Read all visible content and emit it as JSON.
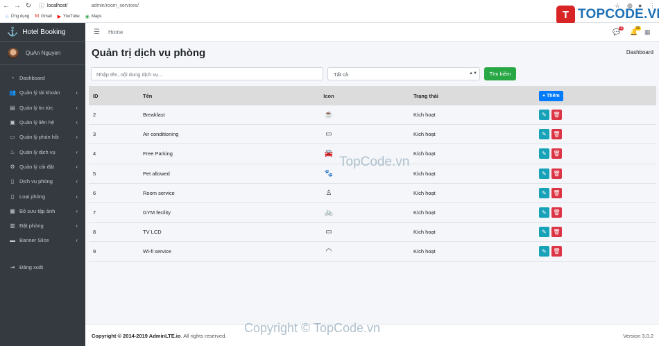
{
  "browser": {
    "url_host": "localhost/",
    "url_path": "admin/room_services/",
    "bookmarks": [
      {
        "label": "Ứng dụng",
        "icon": "apps-icon"
      },
      {
        "label": "Gmail",
        "icon": "gmail-icon"
      },
      {
        "label": "YouTube",
        "icon": "youtube-icon"
      },
      {
        "label": "Maps",
        "icon": "maps-icon"
      }
    ]
  },
  "watermark": {
    "logo_letter": "T",
    "logo_text": "TOPCODE.VN",
    "mid": "TopCode.vn",
    "copy": "Copyright © TopCode.vn"
  },
  "sidebar": {
    "brand": "Hotel Booking",
    "user": "QuAn Nguyen",
    "items": [
      {
        "label": "Dashboard",
        "icon": "dashboard-icon",
        "arrow": ""
      },
      {
        "label": "Quản lý tài khoản",
        "icon": "users-icon",
        "arrow": "‹"
      },
      {
        "label": "Quản lý tin tức",
        "icon": "news-icon",
        "arrow": "‹"
      },
      {
        "label": "Quản lý liên hệ",
        "icon": "contact-icon",
        "arrow": "‹"
      },
      {
        "label": "Quản lý phản hồi",
        "icon": "feedback-icon",
        "arrow": "‹"
      },
      {
        "label": "Quản lý dịch vụ",
        "icon": "service-icon",
        "arrow": "‹"
      },
      {
        "label": "Quản lý cài đặt",
        "icon": "settings-icon",
        "arrow": "‹"
      },
      {
        "label": "Dịch vụ phòng",
        "icon": "room-service-icon",
        "arrow": "‹"
      },
      {
        "label": "Loại phòng",
        "icon": "room-type-icon",
        "arrow": "‹"
      },
      {
        "label": "Bộ sưu tập ảnh",
        "icon": "gallery-icon",
        "arrow": "‹"
      },
      {
        "label": "Đặt phòng",
        "icon": "booking-icon",
        "arrow": "‹"
      },
      {
        "label": "Banner Slice",
        "icon": "banner-icon",
        "arrow": "‹"
      }
    ],
    "logout": "Đăng xuất"
  },
  "topbar": {
    "home": "Home",
    "msg_badge": "3",
    "notif_badge": "15"
  },
  "page": {
    "title": "Quản trị dịch vụ phòng",
    "breadcrumb": "Dashboard"
  },
  "filter": {
    "search_placeholder": "Nhập tên, nội dung dịch vụ...",
    "select_value": "Tất cả",
    "search_button": "Tìm kiếm"
  },
  "table": {
    "headers": {
      "id": "ID",
      "name": "Tên",
      "icon": "Icon",
      "status": "Trạng thái",
      "add": "+ Thêm"
    },
    "rows": [
      {
        "id": "2",
        "name": "Breakfast",
        "icon": "coffee-icon",
        "status": "Kích hoạt"
      },
      {
        "id": "3",
        "name": "Air conditioning",
        "icon": "air-conditioner-icon",
        "status": "Kích hoạt"
      },
      {
        "id": "4",
        "name": "Free Parking",
        "icon": "car-icon",
        "status": "Kích hoạt"
      },
      {
        "id": "5",
        "name": "Pet allowed",
        "icon": "pet-icon",
        "status": "Kích hoạt"
      },
      {
        "id": "6",
        "name": "Room service",
        "icon": "user-service-icon",
        "status": "Kích hoạt"
      },
      {
        "id": "7",
        "name": "GYM fecility",
        "icon": "gym-icon",
        "status": "Kích hoạt"
      },
      {
        "id": "8",
        "name": "TV LCD",
        "icon": "tv-icon",
        "status": "Kích hoạt"
      },
      {
        "id": "9",
        "name": "Wi-fi service",
        "icon": "wifi-icon",
        "status": "Kích hoạt"
      }
    ]
  },
  "footer": {
    "copyright": "Copyright © 2014-2019 ",
    "brand": "AdminLTE.io",
    "rights": ". All rights reserved.",
    "version": "Version 3.0.2"
  }
}
